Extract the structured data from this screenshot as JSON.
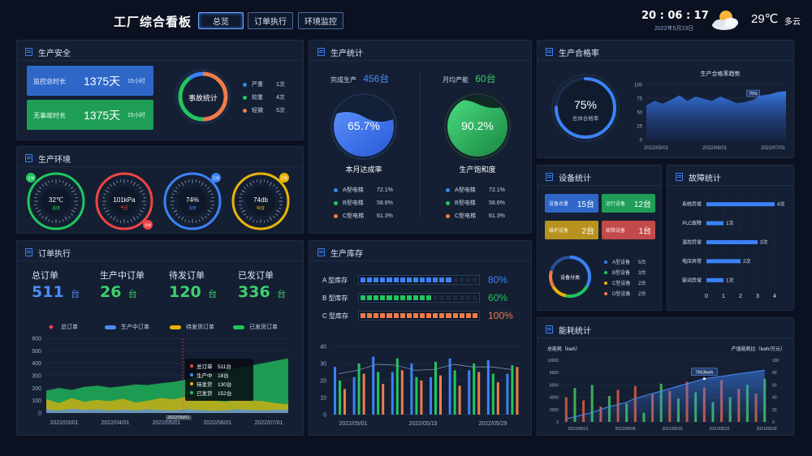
{
  "header": {
    "title": "工厂综合看板",
    "nav": [
      "总览",
      "订单执行",
      "环境监控"
    ],
    "time": "20 : 06 : 17",
    "date": "2022年5月23日",
    "temperature": "29℃",
    "weather": "多云"
  },
  "safety": {
    "title": "生产安全",
    "cards": [
      {
        "label": "监控总时长",
        "value": "1375天",
        "sub": "15小时",
        "color": "#2f67c8"
      },
      {
        "label": "无事故时长",
        "value": "1375天",
        "sub": "15小时",
        "color": "#1f9e57"
      }
    ],
    "donut_label": "事故统计",
    "legend": [
      {
        "name": "严重",
        "value": "1次",
        "color": "#3b82f6"
      },
      {
        "name": "较重",
        "value": "4次",
        "color": "#22c55e"
      },
      {
        "name": "轻微",
        "value": "5次",
        "color": "#f07c4a"
      }
    ]
  },
  "environment": {
    "title": "生产环境",
    "gauges": [
      {
        "value": "32℃",
        "label": "温度",
        "color": "#22c55e",
        "badge": "正常"
      },
      {
        "value": "101kPa",
        "label": "气压",
        "color": "#ef4444",
        "badge": "异常"
      },
      {
        "value": "74%",
        "label": "湿度",
        "color": "#3b82f6",
        "badge": "正常"
      },
      {
        "value": "74db",
        "label": "噪音",
        "color": "#eab308",
        "badge": "正常"
      }
    ]
  },
  "production": {
    "title": "生产统计",
    "left": {
      "label": "完成生产",
      "value": "456台",
      "percent": "65.7%",
      "caption": "本月达成率",
      "color": "#3b82f6"
    },
    "right": {
      "label": "月均产能",
      "value": "60台",
      "percent": "90.2%",
      "caption": "生产饱和度",
      "color": "#22c55e"
    },
    "left_items": [
      {
        "name": "A型电梯",
        "value": "72.1%",
        "color": "#3b82f6"
      },
      {
        "name": "B型电梯",
        "value": "58.6%",
        "color": "#22c55e"
      },
      {
        "name": "C型电梯",
        "value": "61.3%",
        "color": "#f07c4a"
      }
    ],
    "right_items": [
      {
        "name": "A型电梯",
        "value": "72.1%",
        "color": "#3b82f6"
      },
      {
        "name": "B型电梯",
        "value": "58.6%",
        "color": "#22c55e"
      },
      {
        "name": "C型电梯",
        "value": "61.3%",
        "color": "#f07c4a"
      }
    ]
  },
  "quality": {
    "title": "生产合格率",
    "percent": "75%",
    "caption": "总体合格率",
    "trend_title": "生产合格率趋势",
    "tooltip": "75%"
  },
  "orders": {
    "title": "订单执行",
    "stats": [
      {
        "label": "总订单",
        "value": "511",
        "unit": "台",
        "color": "#4d8cf5"
      },
      {
        "label": "生产中订单",
        "value": "26",
        "unit": "台",
        "color": "#3ecf6e"
      },
      {
        "label": "待发订单",
        "value": "120",
        "unit": "台",
        "color": "#3ecf6e"
      },
      {
        "label": "已发订单",
        "value": "336",
        "unit": "台",
        "color": "#3ecf6e"
      }
    ],
    "legend": [
      {
        "name": "总订单",
        "color": "#ef4444"
      },
      {
        "name": "生产中订单",
        "color": "#4d8cf5"
      },
      {
        "name": "待发货订单",
        "color": "#eab308"
      },
      {
        "name": "已发货订单",
        "color": "#22c55e"
      }
    ],
    "tooltip": [
      {
        "name": "总订单",
        "value": "511台",
        "color": "#ef4444"
      },
      {
        "name": "生产中",
        "value": "18台",
        "color": "#4d8cf5"
      },
      {
        "name": "待发货",
        "value": "130台",
        "color": "#eab308"
      },
      {
        "name": "已发货",
        "value": "152台",
        "color": "#22c55e"
      }
    ],
    "tooltip_date": "2022/05/01"
  },
  "inventory": {
    "title": "生产库存",
    "bars": [
      {
        "label": "A 型库存",
        "percent": "80%",
        "fraction": 0.8,
        "color": "#3b82f6"
      },
      {
        "label": "B 型库存",
        "percent": "60%",
        "fraction": 0.6,
        "color": "#22c55e"
      },
      {
        "label": "C 型库存",
        "percent": "100%",
        "fraction": 1.0,
        "color": "#f07c4a"
      }
    ]
  },
  "equipment": {
    "title": "设备统计",
    "tiles": [
      {
        "label": "设备总量",
        "value": "15台",
        "color": "#2f67c8"
      },
      {
        "label": "运行设备",
        "value": "12台",
        "color": "#1f9e57"
      },
      {
        "label": "维护设备",
        "value": "2台",
        "color": "#b8921f"
      },
      {
        "label": "故障设备",
        "value": "1台",
        "color": "#c24a4a"
      }
    ],
    "donut_label": "设备分类",
    "legend": [
      {
        "name": "A型设备",
        "value": "5台",
        "color": "#3b82f6"
      },
      {
        "name": "B型设备",
        "value": "3台",
        "color": "#22c55e"
      },
      {
        "name": "C型设备",
        "value": "2台",
        "color": "#eab308"
      },
      {
        "name": "D型设备",
        "value": "2台",
        "color": "#f07c4a"
      }
    ]
  },
  "faults": {
    "title": "故障统计"
  },
  "energy": {
    "title": "能耗统计",
    "tooltip": "7653kwh"
  },
  "chart_data": [
    {
      "type": "area",
      "name": "quality_trend",
      "title": "生产合格率趋势",
      "x": [
        "2022/05/01",
        "2022/06/01",
        "2022/07/01"
      ],
      "ylim": [
        0,
        100
      ],
      "yticks": [
        0,
        25,
        50,
        75,
        100
      ],
      "values": [
        62,
        70,
        65,
        72,
        80,
        70,
        78,
        74,
        70,
        78,
        72,
        66,
        68,
        72,
        80,
        82,
        86,
        88
      ]
    },
    {
      "type": "bar",
      "name": "fault_stats",
      "categories": [
        "系统异常",
        "PLC故障",
        "温控异常",
        "电压异常",
        "驱动异常"
      ],
      "values": [
        4,
        1,
        3,
        2,
        1
      ],
      "value_labels": [
        "4次",
        "1次",
        "3次",
        "2次",
        "1次"
      ],
      "xlim": [
        0,
        4
      ],
      "xticks": [
        0,
        1,
        2,
        3,
        4
      ]
    },
    {
      "type": "area",
      "name": "order_trend",
      "x": [
        "2022/03/01",
        "2022/04/01",
        "2022/05/01",
        "2022/06/01",
        "2022/07/01"
      ],
      "ylim": [
        0,
        600
      ],
      "yticks": [
        0,
        100,
        200,
        300,
        400,
        500,
        600
      ],
      "series": [
        {
          "name": "已发货订单",
          "values": [
            180,
            200,
            185,
            210,
            220,
            205,
            215,
            230,
            225,
            240,
            250,
            270,
            300,
            320,
            340,
            360,
            380,
            400,
            420,
            440
          ]
        },
        {
          "name": "待发货订单",
          "values": [
            110,
            80,
            120,
            90,
            105,
            95,
            115,
            85,
            100,
            120,
            110,
            130,
            100,
            105,
            90,
            110,
            100,
            95,
            80,
            70
          ]
        },
        {
          "name": "生产中订单",
          "values": [
            30,
            20,
            35,
            25,
            30,
            20,
            28,
            22,
            30,
            25,
            20,
            30,
            25,
            18,
            22,
            30,
            25,
            20,
            28,
            24
          ]
        }
      ]
    },
    {
      "type": "bar",
      "name": "inventory_trend",
      "x": [
        "2022/05/01",
        "2022/05/15",
        "2022/05/29"
      ],
      "ylim": [
        0,
        40
      ],
      "yticks": [
        0,
        10,
        20,
        30,
        40
      ],
      "series": [
        {
          "name": "A型",
          "values": [
            28,
            22,
            34,
            25,
            30,
            22,
            33,
            26,
            32,
            24
          ]
        },
        {
          "name": "B型",
          "values": [
            20,
            30,
            25,
            33,
            22,
            31,
            26,
            30,
            24,
            29
          ]
        },
        {
          "name": "C型",
          "values": [
            15,
            24,
            18,
            26,
            20,
            23,
            17,
            25,
            19,
            28
          ]
        }
      ]
    },
    {
      "type": "bar",
      "name": "energy_trend",
      "xlabel": "",
      "ylabel": "总能耗（kwh）",
      "y2label": "产值能耗比（kwh/万元）",
      "x": [
        "2021/05/01",
        "2021/05/08",
        "2021/05/15",
        "2021/05/22",
        "2021/05/29"
      ],
      "ylim": [
        0,
        10000
      ],
      "yticks": [
        0,
        2000,
        4000,
        6000,
        8000,
        10000
      ],
      "y2ticks": [
        0,
        20,
        40,
        60,
        80,
        100
      ],
      "bars": [
        4000,
        5500,
        3500,
        6000,
        2500,
        4200,
        5200,
        3000,
        5800,
        1500,
        4500,
        6200,
        5000,
        3800,
        6500,
        4800,
        5600,
        3200,
        6800,
        4000,
        5400,
        6000,
        4600,
        7000
      ],
      "line": [
        5,
        8,
        12,
        15,
        20,
        25,
        28,
        32,
        38,
        42,
        46,
        50,
        54,
        58,
        62,
        66,
        70,
        72,
        74,
        76,
        78,
        80,
        82,
        84
      ]
    }
  ]
}
